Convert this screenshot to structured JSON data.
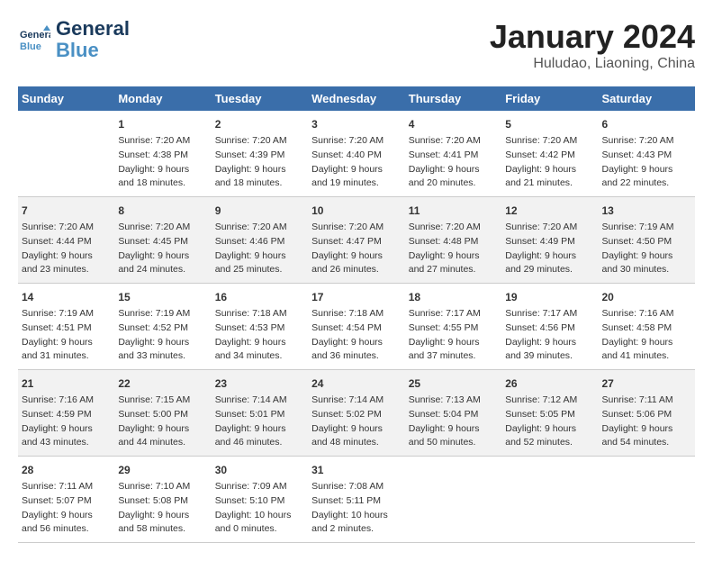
{
  "header": {
    "logo_line1": "General",
    "logo_line2": "Blue",
    "title": "January 2024",
    "subtitle": "Huludao, Liaoning, China"
  },
  "columns": [
    "Sunday",
    "Monday",
    "Tuesday",
    "Wednesday",
    "Thursday",
    "Friday",
    "Saturday"
  ],
  "weeks": [
    [
      {
        "day": "",
        "info": ""
      },
      {
        "day": "1",
        "info": "Sunrise: 7:20 AM\nSunset: 4:38 PM\nDaylight: 9 hours\nand 18 minutes."
      },
      {
        "day": "2",
        "info": "Sunrise: 7:20 AM\nSunset: 4:39 PM\nDaylight: 9 hours\nand 18 minutes."
      },
      {
        "day": "3",
        "info": "Sunrise: 7:20 AM\nSunset: 4:40 PM\nDaylight: 9 hours\nand 19 minutes."
      },
      {
        "day": "4",
        "info": "Sunrise: 7:20 AM\nSunset: 4:41 PM\nDaylight: 9 hours\nand 20 minutes."
      },
      {
        "day": "5",
        "info": "Sunrise: 7:20 AM\nSunset: 4:42 PM\nDaylight: 9 hours\nand 21 minutes."
      },
      {
        "day": "6",
        "info": "Sunrise: 7:20 AM\nSunset: 4:43 PM\nDaylight: 9 hours\nand 22 minutes."
      }
    ],
    [
      {
        "day": "7",
        "info": "Sunrise: 7:20 AM\nSunset: 4:44 PM\nDaylight: 9 hours\nand 23 minutes."
      },
      {
        "day": "8",
        "info": "Sunrise: 7:20 AM\nSunset: 4:45 PM\nDaylight: 9 hours\nand 24 minutes."
      },
      {
        "day": "9",
        "info": "Sunrise: 7:20 AM\nSunset: 4:46 PM\nDaylight: 9 hours\nand 25 minutes."
      },
      {
        "day": "10",
        "info": "Sunrise: 7:20 AM\nSunset: 4:47 PM\nDaylight: 9 hours\nand 26 minutes."
      },
      {
        "day": "11",
        "info": "Sunrise: 7:20 AM\nSunset: 4:48 PM\nDaylight: 9 hours\nand 27 minutes."
      },
      {
        "day": "12",
        "info": "Sunrise: 7:20 AM\nSunset: 4:49 PM\nDaylight: 9 hours\nand 29 minutes."
      },
      {
        "day": "13",
        "info": "Sunrise: 7:19 AM\nSunset: 4:50 PM\nDaylight: 9 hours\nand 30 minutes."
      }
    ],
    [
      {
        "day": "14",
        "info": "Sunrise: 7:19 AM\nSunset: 4:51 PM\nDaylight: 9 hours\nand 31 minutes."
      },
      {
        "day": "15",
        "info": "Sunrise: 7:19 AM\nSunset: 4:52 PM\nDaylight: 9 hours\nand 33 minutes."
      },
      {
        "day": "16",
        "info": "Sunrise: 7:18 AM\nSunset: 4:53 PM\nDaylight: 9 hours\nand 34 minutes."
      },
      {
        "day": "17",
        "info": "Sunrise: 7:18 AM\nSunset: 4:54 PM\nDaylight: 9 hours\nand 36 minutes."
      },
      {
        "day": "18",
        "info": "Sunrise: 7:17 AM\nSunset: 4:55 PM\nDaylight: 9 hours\nand 37 minutes."
      },
      {
        "day": "19",
        "info": "Sunrise: 7:17 AM\nSunset: 4:56 PM\nDaylight: 9 hours\nand 39 minutes."
      },
      {
        "day": "20",
        "info": "Sunrise: 7:16 AM\nSunset: 4:58 PM\nDaylight: 9 hours\nand 41 minutes."
      }
    ],
    [
      {
        "day": "21",
        "info": "Sunrise: 7:16 AM\nSunset: 4:59 PM\nDaylight: 9 hours\nand 43 minutes."
      },
      {
        "day": "22",
        "info": "Sunrise: 7:15 AM\nSunset: 5:00 PM\nDaylight: 9 hours\nand 44 minutes."
      },
      {
        "day": "23",
        "info": "Sunrise: 7:14 AM\nSunset: 5:01 PM\nDaylight: 9 hours\nand 46 minutes."
      },
      {
        "day": "24",
        "info": "Sunrise: 7:14 AM\nSunset: 5:02 PM\nDaylight: 9 hours\nand 48 minutes."
      },
      {
        "day": "25",
        "info": "Sunrise: 7:13 AM\nSunset: 5:04 PM\nDaylight: 9 hours\nand 50 minutes."
      },
      {
        "day": "26",
        "info": "Sunrise: 7:12 AM\nSunset: 5:05 PM\nDaylight: 9 hours\nand 52 minutes."
      },
      {
        "day": "27",
        "info": "Sunrise: 7:11 AM\nSunset: 5:06 PM\nDaylight: 9 hours\nand 54 minutes."
      }
    ],
    [
      {
        "day": "28",
        "info": "Sunrise: 7:11 AM\nSunset: 5:07 PM\nDaylight: 9 hours\nand 56 minutes."
      },
      {
        "day": "29",
        "info": "Sunrise: 7:10 AM\nSunset: 5:08 PM\nDaylight: 9 hours\nand 58 minutes."
      },
      {
        "day": "30",
        "info": "Sunrise: 7:09 AM\nSunset: 5:10 PM\nDaylight: 10 hours\nand 0 minutes."
      },
      {
        "day": "31",
        "info": "Sunrise: 7:08 AM\nSunset: 5:11 PM\nDaylight: 10 hours\nand 2 minutes."
      },
      {
        "day": "",
        "info": ""
      },
      {
        "day": "",
        "info": ""
      },
      {
        "day": "",
        "info": ""
      }
    ]
  ]
}
